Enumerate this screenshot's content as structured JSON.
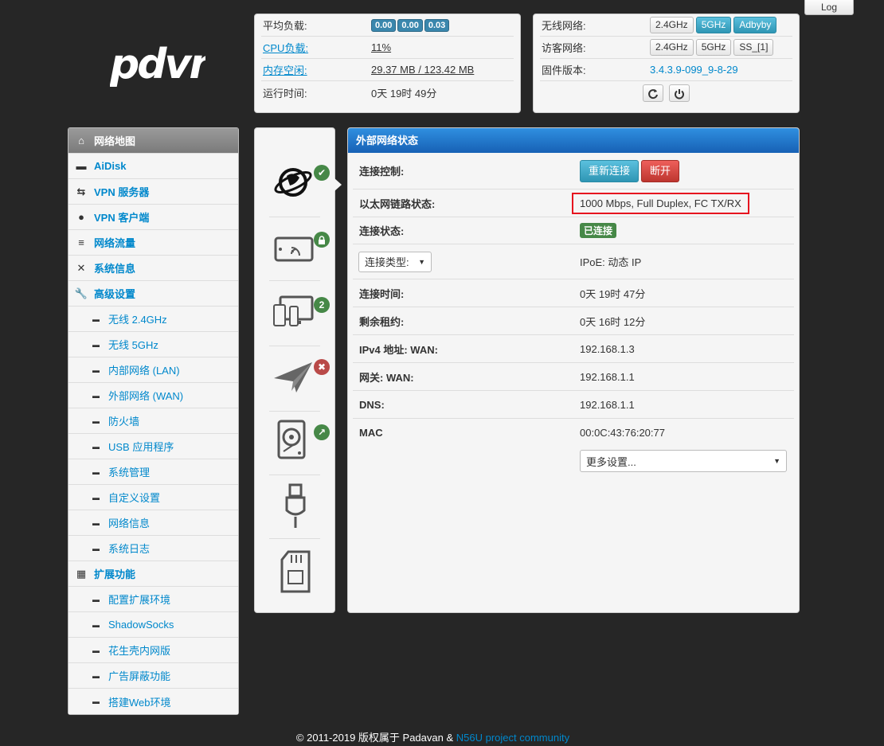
{
  "top": {
    "log_label": "Log",
    "logo_text": "padavan"
  },
  "status_panel": {
    "avg_load_label": "平均负载:",
    "avg_load_values": [
      "0.00",
      "0.00",
      "0.03"
    ],
    "cpu_label": "CPU负载:",
    "cpu_value": "11%",
    "mem_label": "内存空闲:",
    "mem_value": "29.37 MB / 123.42 MB",
    "uptime_label": "运行时间:",
    "uptime_value": "0天 19时 49分"
  },
  "net_panel": {
    "wireless_label": "无线网络:",
    "wireless_btns": [
      "2.4GHz",
      "5GHz",
      "Adbyby"
    ],
    "guest_label": "访客网络:",
    "guest_btns": [
      "2.4GHz",
      "5GHz",
      "SS_[1]"
    ],
    "fw_label": "固件版本:",
    "fw_value": "3.4.3.9-099_9-8-29",
    "refresh_icon": "refresh-icon",
    "power_icon": "power-icon"
  },
  "sidebar": {
    "items": [
      {
        "label": "网络地图",
        "icon": "home-icon"
      },
      {
        "label": "AiDisk",
        "icon": "hdd-icon"
      },
      {
        "label": "VPN 服务器",
        "icon": "retweet-icon"
      },
      {
        "label": "VPN 客户端",
        "icon": "globe-icon"
      },
      {
        "label": "网络流量",
        "icon": "list-icon"
      },
      {
        "label": "系统信息",
        "icon": "random-icon"
      },
      {
        "label": "高级设置",
        "icon": "wrench-icon"
      },
      {
        "label": "无线 2.4GHz"
      },
      {
        "label": "无线 5GHz"
      },
      {
        "label": "内部网络 (LAN)"
      },
      {
        "label": "外部网络 (WAN)"
      },
      {
        "label": "防火墙"
      },
      {
        "label": "USB 应用程序"
      },
      {
        "label": "系统管理"
      },
      {
        "label": "自定义设置"
      },
      {
        "label": "网络信息"
      },
      {
        "label": "系统日志"
      },
      {
        "label": "扩展功能",
        "icon": "grid-icon"
      },
      {
        "label": "配置扩展环境"
      },
      {
        "label": "ShadowSocks"
      },
      {
        "label": "花生壳内网版"
      },
      {
        "label": "广告屏蔽功能"
      },
      {
        "label": "搭建Web环境"
      }
    ]
  },
  "icons": {
    "badges": [
      "✔",
      "🔒",
      "2",
      "✖",
      "↗"
    ],
    "colors": {
      "ok": "#468847",
      "err": "#b94a48",
      "info": "#468847"
    }
  },
  "wan": {
    "title": "外部网络状态",
    "control_label": "连接控制:",
    "reconnect_label": "重新连接",
    "disconnect_label": "断开",
    "link_label": "以太网链路状态:",
    "link_value": "1000 Mbps, Full Duplex, FC TX/RX",
    "status_label": "连接状态:",
    "status_value": "已连接",
    "type_select": "连接类型:",
    "type_value": "IPoE: 动态 IP",
    "conn_time_label": "连接时间:",
    "conn_time_value": "0天 19时 47分",
    "lease_label": "剩余租约:",
    "lease_value": "0天 16时 12分",
    "ipv4_label": "IPv4 地址: WAN:",
    "ipv4_value": "192.168.1.3",
    "gw_label": "网关: WAN:",
    "gw_value": "192.168.1.1",
    "dns_label": "DNS:",
    "dns_value": "192.168.1.1",
    "mac_label": "MAC",
    "mac_value": "00:0C:43:76:20:77",
    "more_select": "更多设置..."
  },
  "footer": {
    "copyright": "© 2011-2019 版权属于 Padavan & ",
    "link": "N56U project community"
  }
}
